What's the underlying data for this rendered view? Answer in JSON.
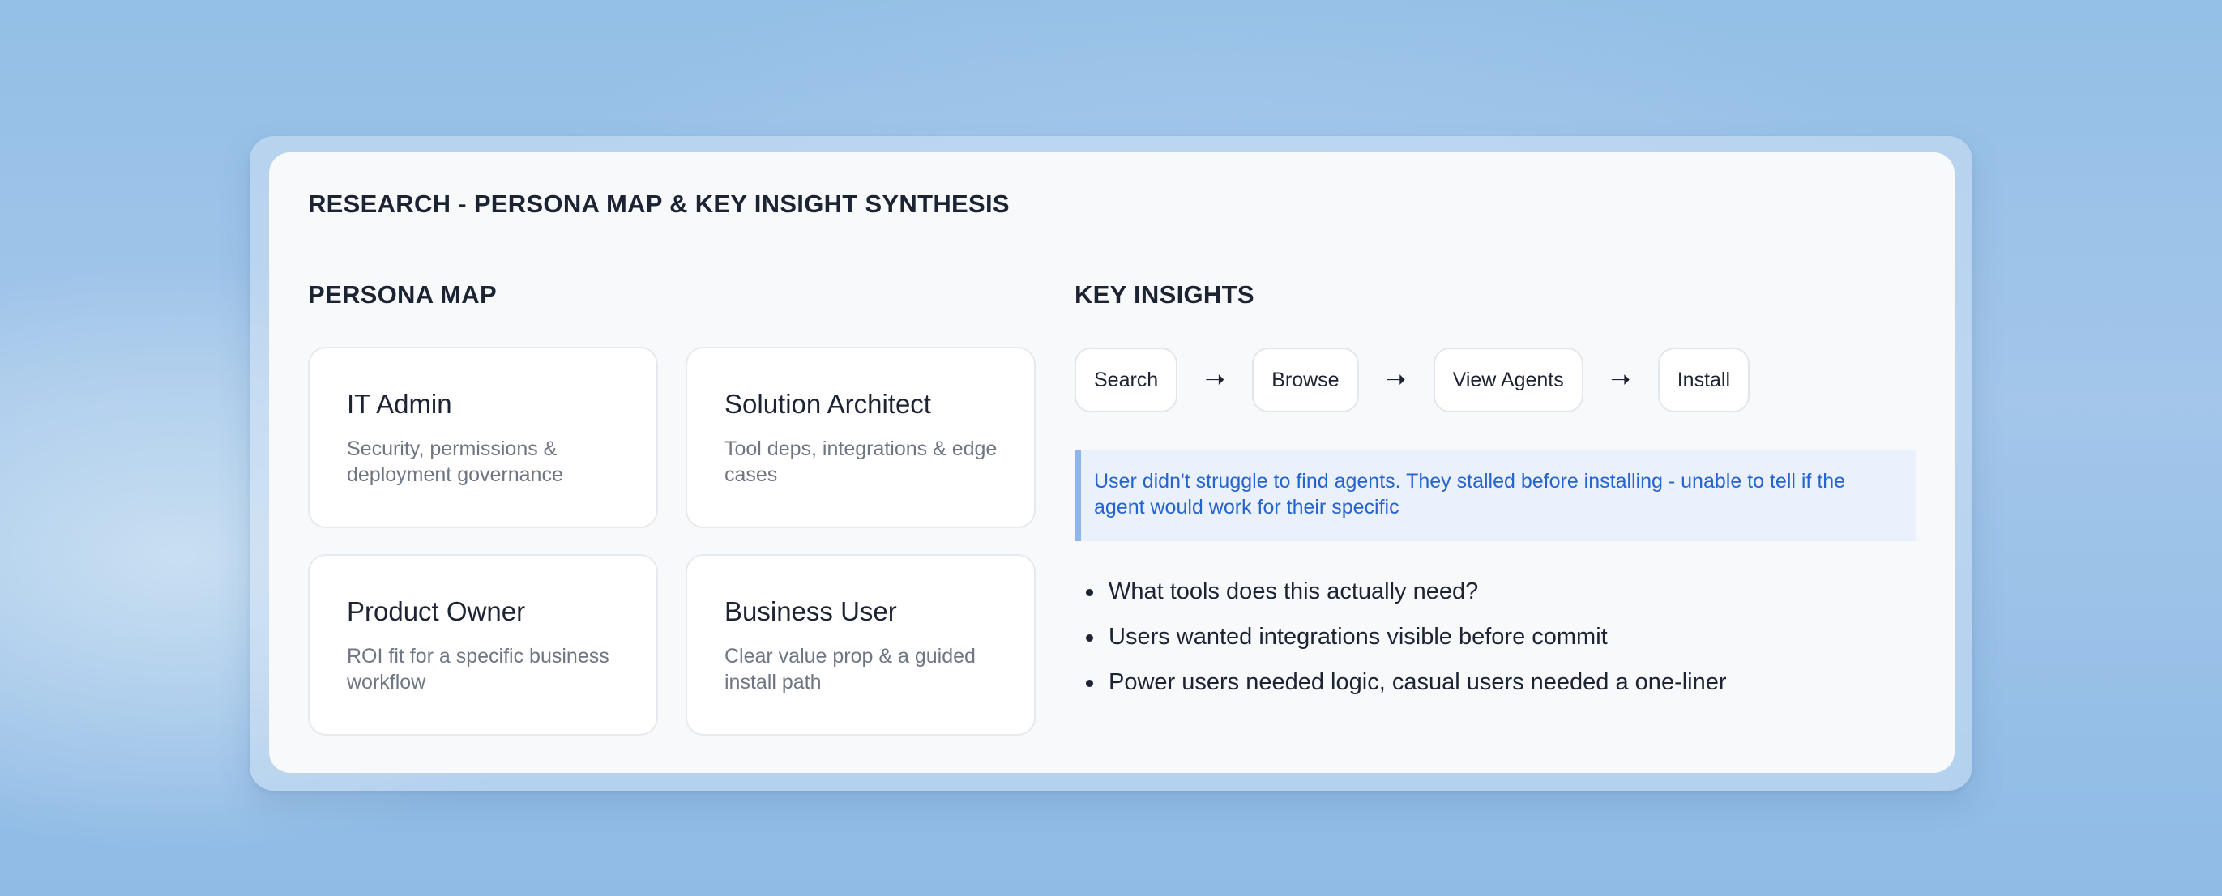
{
  "page_title": "RESEARCH - PERSONA MAP & KEY INSIGHT SYNTHESIS",
  "persona_map": {
    "title": "PERSONA MAP",
    "personas": [
      {
        "name": "IT Admin",
        "description": "Security, permissions & deployment governance"
      },
      {
        "name": "Solution Architect",
        "description": "Tool deps, integrations & edge cases"
      },
      {
        "name": "Product Owner",
        "description": "ROI fit for a specific business workflow"
      },
      {
        "name": "Business User",
        "description": "Clear value prop & a guided install path"
      }
    ]
  },
  "key_insights": {
    "title": "KEY INSIGHTS",
    "flow": {
      "steps": [
        "Search",
        "Browse",
        "View Agents",
        "Install"
      ],
      "arrow_icon": "arrow-right-icon"
    },
    "callout": "User didn't struggle to find agents. They stalled before installing - unable to tell if the agent would work for their specific",
    "bullets": [
      "What tools does this actually need?",
      "Users wanted integrations visible before commit",
      "Power users needed logic, casual users needed a one-liner"
    ]
  },
  "colors": {
    "background": "#9fc4e9",
    "card": "#f8f9fb",
    "heading": "#1c2333",
    "muted_text": "#6f7683",
    "callout_text": "#2563cf",
    "callout_bg": "#eaf1fc",
    "callout_border": "#8db6ec"
  }
}
